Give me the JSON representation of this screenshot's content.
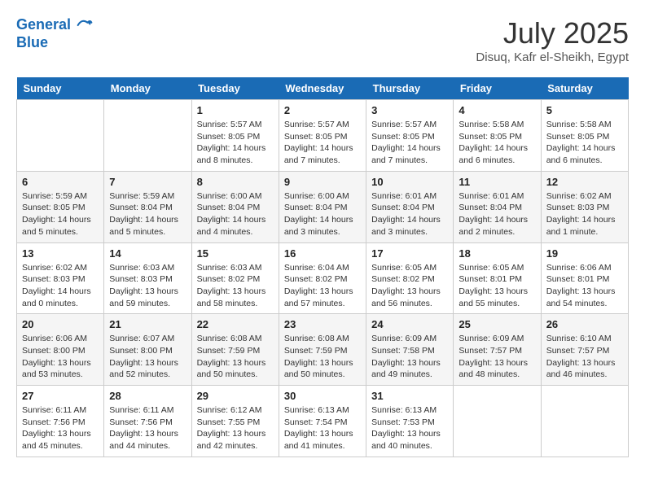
{
  "header": {
    "logo_line1": "General",
    "logo_line2": "Blue",
    "month_year": "July 2025",
    "location": "Disuq, Kafr el-Sheikh, Egypt"
  },
  "weekdays": [
    "Sunday",
    "Monday",
    "Tuesday",
    "Wednesday",
    "Thursday",
    "Friday",
    "Saturday"
  ],
  "weeks": [
    [
      {
        "day": "",
        "info": ""
      },
      {
        "day": "",
        "info": ""
      },
      {
        "day": "1",
        "info": "Sunrise: 5:57 AM\nSunset: 8:05 PM\nDaylight: 14 hours and 8 minutes."
      },
      {
        "day": "2",
        "info": "Sunrise: 5:57 AM\nSunset: 8:05 PM\nDaylight: 14 hours and 7 minutes."
      },
      {
        "day": "3",
        "info": "Sunrise: 5:57 AM\nSunset: 8:05 PM\nDaylight: 14 hours and 7 minutes."
      },
      {
        "day": "4",
        "info": "Sunrise: 5:58 AM\nSunset: 8:05 PM\nDaylight: 14 hours and 6 minutes."
      },
      {
        "day": "5",
        "info": "Sunrise: 5:58 AM\nSunset: 8:05 PM\nDaylight: 14 hours and 6 minutes."
      }
    ],
    [
      {
        "day": "6",
        "info": "Sunrise: 5:59 AM\nSunset: 8:05 PM\nDaylight: 14 hours and 5 minutes."
      },
      {
        "day": "7",
        "info": "Sunrise: 5:59 AM\nSunset: 8:04 PM\nDaylight: 14 hours and 5 minutes."
      },
      {
        "day": "8",
        "info": "Sunrise: 6:00 AM\nSunset: 8:04 PM\nDaylight: 14 hours and 4 minutes."
      },
      {
        "day": "9",
        "info": "Sunrise: 6:00 AM\nSunset: 8:04 PM\nDaylight: 14 hours and 3 minutes."
      },
      {
        "day": "10",
        "info": "Sunrise: 6:01 AM\nSunset: 8:04 PM\nDaylight: 14 hours and 3 minutes."
      },
      {
        "day": "11",
        "info": "Sunrise: 6:01 AM\nSunset: 8:04 PM\nDaylight: 14 hours and 2 minutes."
      },
      {
        "day": "12",
        "info": "Sunrise: 6:02 AM\nSunset: 8:03 PM\nDaylight: 14 hours and 1 minute."
      }
    ],
    [
      {
        "day": "13",
        "info": "Sunrise: 6:02 AM\nSunset: 8:03 PM\nDaylight: 14 hours and 0 minutes."
      },
      {
        "day": "14",
        "info": "Sunrise: 6:03 AM\nSunset: 8:03 PM\nDaylight: 13 hours and 59 minutes."
      },
      {
        "day": "15",
        "info": "Sunrise: 6:03 AM\nSunset: 8:02 PM\nDaylight: 13 hours and 58 minutes."
      },
      {
        "day": "16",
        "info": "Sunrise: 6:04 AM\nSunset: 8:02 PM\nDaylight: 13 hours and 57 minutes."
      },
      {
        "day": "17",
        "info": "Sunrise: 6:05 AM\nSunset: 8:02 PM\nDaylight: 13 hours and 56 minutes."
      },
      {
        "day": "18",
        "info": "Sunrise: 6:05 AM\nSunset: 8:01 PM\nDaylight: 13 hours and 55 minutes."
      },
      {
        "day": "19",
        "info": "Sunrise: 6:06 AM\nSunset: 8:01 PM\nDaylight: 13 hours and 54 minutes."
      }
    ],
    [
      {
        "day": "20",
        "info": "Sunrise: 6:06 AM\nSunset: 8:00 PM\nDaylight: 13 hours and 53 minutes."
      },
      {
        "day": "21",
        "info": "Sunrise: 6:07 AM\nSunset: 8:00 PM\nDaylight: 13 hours and 52 minutes."
      },
      {
        "day": "22",
        "info": "Sunrise: 6:08 AM\nSunset: 7:59 PM\nDaylight: 13 hours and 50 minutes."
      },
      {
        "day": "23",
        "info": "Sunrise: 6:08 AM\nSunset: 7:59 PM\nDaylight: 13 hours and 50 minutes."
      },
      {
        "day": "24",
        "info": "Sunrise: 6:09 AM\nSunset: 7:58 PM\nDaylight: 13 hours and 49 minutes."
      },
      {
        "day": "25",
        "info": "Sunrise: 6:09 AM\nSunset: 7:57 PM\nDaylight: 13 hours and 48 minutes."
      },
      {
        "day": "26",
        "info": "Sunrise: 6:10 AM\nSunset: 7:57 PM\nDaylight: 13 hours and 46 minutes."
      }
    ],
    [
      {
        "day": "27",
        "info": "Sunrise: 6:11 AM\nSunset: 7:56 PM\nDaylight: 13 hours and 45 minutes."
      },
      {
        "day": "28",
        "info": "Sunrise: 6:11 AM\nSunset: 7:56 PM\nDaylight: 13 hours and 44 minutes."
      },
      {
        "day": "29",
        "info": "Sunrise: 6:12 AM\nSunset: 7:55 PM\nDaylight: 13 hours and 42 minutes."
      },
      {
        "day": "30",
        "info": "Sunrise: 6:13 AM\nSunset: 7:54 PM\nDaylight: 13 hours and 41 minutes."
      },
      {
        "day": "31",
        "info": "Sunrise: 6:13 AM\nSunset: 7:53 PM\nDaylight: 13 hours and 40 minutes."
      },
      {
        "day": "",
        "info": ""
      },
      {
        "day": "",
        "info": ""
      }
    ]
  ]
}
